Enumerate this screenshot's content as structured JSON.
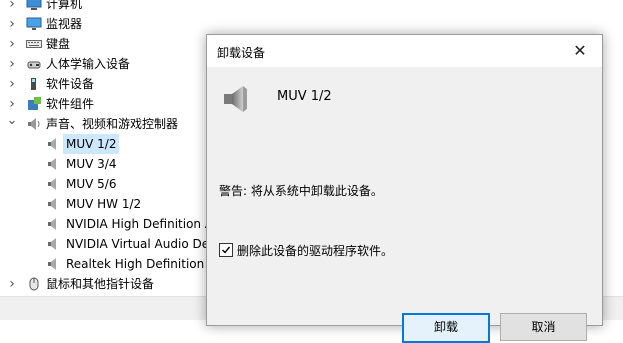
{
  "tree": {
    "items": [
      {
        "label": "计算机",
        "icon": "computer-icon",
        "expanded": false
      },
      {
        "label": "监视器",
        "icon": "monitor-icon",
        "expanded": false
      },
      {
        "label": "键盘",
        "icon": "keyboard-icon",
        "expanded": false
      },
      {
        "label": "人体学输入设备",
        "icon": "hid-icon",
        "expanded": false
      },
      {
        "label": "软件设备",
        "icon": "software-device-icon",
        "expanded": false
      },
      {
        "label": "软件组件",
        "icon": "software-component-icon",
        "expanded": false
      },
      {
        "label": "声音、视频和游戏控制器",
        "icon": "sound-icon",
        "expanded": true
      },
      {
        "label": "MUV 1/2",
        "icon": "speaker-icon",
        "child": true,
        "selected": true
      },
      {
        "label": "MUV 3/4",
        "icon": "speaker-icon",
        "child": true
      },
      {
        "label": "MUV 5/6",
        "icon": "speaker-icon",
        "child": true
      },
      {
        "label": "MUV HW 1/2",
        "icon": "speaker-icon",
        "child": true
      },
      {
        "label": "NVIDIA High Definition A",
        "icon": "speaker-icon",
        "child": true
      },
      {
        "label": "NVIDIA Virtual Audio De",
        "icon": "speaker-icon",
        "child": true
      },
      {
        "label": "Realtek High Definition A",
        "icon": "speaker-icon",
        "child": true
      },
      {
        "label": "鼠标和其他指针设备",
        "icon": "mouse-icon",
        "expanded": false
      }
    ]
  },
  "dialog": {
    "title": "卸载设备",
    "close_icon": "close-icon",
    "device_name": "MUV 1/2",
    "warning": "警告: 将从系统中卸载此设备。",
    "checkbox_label": "删除此设备的驱动程序软件。",
    "checkbox_checked": true,
    "uninstall_button": "卸载",
    "cancel_button": "取消"
  },
  "colors": {
    "selection": "#cce8ff",
    "accent": "#0078d7",
    "dialog_bg": "#f0f0f0"
  }
}
